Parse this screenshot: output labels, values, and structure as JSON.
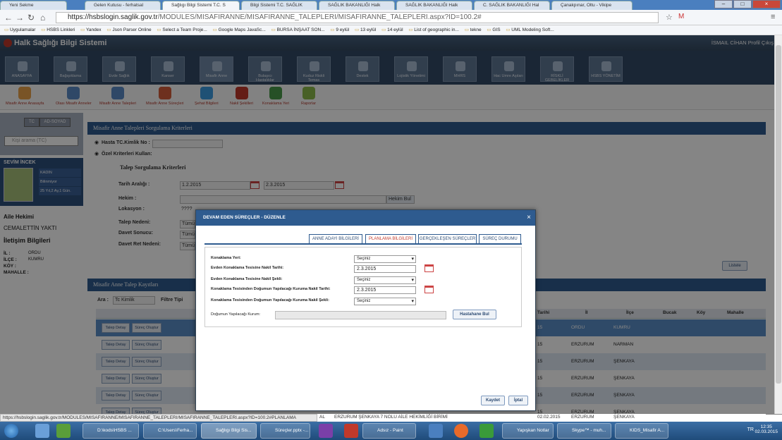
{
  "browser": {
    "tabs": [
      "Yeni Sekme",
      "Gelen Kutusu - ferhatsal",
      "Sağlıgı Bilgi Sistemi T.C. S",
      "Bilgi Sistemi T.C. SAĞLIK",
      "SAĞLIK BAKANLIĞI Halk",
      "SAĞLIK BAKANLIĞI Halk",
      "C. SAĞLIK BAKANLIĞI Hal",
      "Çanakpınar, Oltu - Vikipe"
    ],
    "url_host": "https://hsbslogin.saglik.gov.tr",
    "url_path": "/MODULES/MISAFIRANNE/MISAFIRANNE_TALEPLERI/MISAFIRANNE_TALEPLERI.aspx?ID=100.2#",
    "bookmarks": [
      "Uygulamalar",
      "HSBS Linkleri",
      "Yandex",
      "Json Parser Online",
      "Select a Team Proje...",
      "Google Maps JavaSc...",
      "BURSA İNŞAAT SON...",
      "9 eylül",
      "13 eylül",
      "14 eylül",
      "List of geographic in...",
      "tekne",
      "GIS",
      "UML Modeling Soft..."
    ]
  },
  "app": {
    "title": "Halk Sağlığı Bilgi Sistemi",
    "profile": "İSMAIL CİHAN Profil Çıkış",
    "modules": [
      "ANASAYFA",
      "Bağışıklama",
      "Evde Sağlık",
      "Kanser",
      "Misafir Anne",
      "Bulaşıcı Hastalıklar",
      "Kuduz Riskli Temas",
      "Destek",
      "Lojistik Yönetimi",
      "MHRS",
      "Hac Umre Aşıları",
      "RİSKLİ GEBELİKLER",
      "HSBS YÖNETİM"
    ],
    "submodules": [
      "Misafir Anne Anasayfa",
      "Olası Misafir Anneler",
      "Misafir Anne Talepleri",
      "Misafir Anne Süreçleri",
      "Şehat Bilgileri",
      "Nakil Şekilleri",
      "Konaklama Yeri",
      "Raporlar"
    ]
  },
  "left": {
    "btn_tc": "TC",
    "btn_name": "AD-SOYAD",
    "search_placeholder": "Kişi arama (TC)",
    "user_name": "SEVİM İNCEK",
    "attrs": [
      "KADIN",
      "Bilinmiyor",
      "25 Yıl,2 Ay,1 Gün."
    ],
    "aile_hekimi_label": "Aile Hekimi",
    "aile_hekimi": "CEMALETTİN YAKTI",
    "iletisim": "İletişim Bilgileri",
    "il_label": "İL :",
    "il": "ORDU",
    "ilce_label": "İLÇE :",
    "ilce": "KUMRU",
    "koy_label": "KÖY :",
    "mahalle_label": "MAHALLE :"
  },
  "main": {
    "criteria_title": "Misafir Anne Talepleri Sorgulama Kriterleri",
    "hasta_tc": "Hasta TC.Kimlik No :",
    "ozel": "Özel Kriterleri Kullan:",
    "talep_title": "Talep Sorgulama Kriterleri",
    "tarih_label": "Tarih Aralığı :",
    "tarih_from": "1.2.2015",
    "tarih_to": "2.3.2015",
    "hekim_label": "Hekim :",
    "hekim_bul": "Hekim Bul",
    "lokasyon_label": "Lokasyon :",
    "lokasyon": "????",
    "talep_nedeni": "Talep Nedeni:",
    "davet_sonucu": "Davet Sonucu:",
    "davet_ret": "Davet Ret Nedeni:",
    "tumu": "Tümü",
    "listele": "Listele",
    "records_title": "Misafir Anne Talep Kayıtları",
    "ara": "Ara :",
    "ara_value": "Tc Kimlik",
    "filtre": "Filtre Tipi",
    "columns": [
      "Tarihi",
      "İl",
      "İlçe",
      "Bucak",
      "Köy",
      "Mahalle"
    ],
    "rows": [
      {
        "date": "15",
        "il": "ORDU",
        "ilce": "KUMRU"
      },
      {
        "date": "15",
        "il": "ERZURUM",
        "ilce": "NARMAN"
      },
      {
        "date": "15",
        "il": "ERZURUM",
        "ilce": "ŞENKAYA"
      },
      {
        "date": "15",
        "il": "ERZURUM",
        "ilce": "ŞENKAYA"
      },
      {
        "date": "15",
        "il": "ERZURUM",
        "ilce": "ŞENKAYA"
      },
      {
        "date": "15",
        "il": "ERZURUM",
        "ilce": "ŞENKAYA"
      }
    ],
    "talep_detay": "Talep Detay",
    "surec_olustur": "Süreç Oluştur",
    "last_row_text": "ERZURUM ŞENKAYA 7 NOLU AİLE HEKİMLİĞİ BİRİMİ",
    "last_row_date": "02.02.2015",
    "last_row_il": "ERZURUM",
    "last_row_ilce": "ŞENKAYA",
    "last_row_prefix": "AL"
  },
  "modal": {
    "title": "DEVAM EDEN SÜREÇLER - DÜZENLE",
    "tabs": [
      "ANNE ADAYI BİLGİLERİ",
      "PLANLAMA BİLGİLERİ",
      "GERÇEKLEŞEN SÜREÇLER",
      "SÜREÇ DURUMU"
    ],
    "konaklama_yeri": "Konaklama Yeri:",
    "nakil_tarihi": "Evden Konaklama Tesisine Nakil Tarihi:",
    "nakil_sekli": "Evden Konaklama Tesisine Nakil Şekli:",
    "kurum_nakil_tarihi": "Konaklama Tesisinden Doğumun Yapılacağı Kuruma Nakil Tarihi:",
    "kurum_nakil_sekli": "Konaklama Tesisinden Doğumun Yapılacağı Kuruma Nakil Şekli:",
    "dogum_kurum": "Doğumun Yapılacağı Kurum:",
    "seciniz": "Seçiniz",
    "date1": "2.3.2015",
    "date2": "2.3.2015",
    "hastahane_bul": "Hastahane Bul",
    "kaydet": "Kaydet",
    "iptal": "İptal"
  },
  "status_url": "https://hsbslogin.saglik.gov.tr/MODULES/MISAFIRANNE/MISAFIRANNE_TALEPLERI/MISAFIRANNE_TALEPLERI.aspx?ID=100.2#PLANLAMA",
  "taskbar": {
    "items": [
      "D:\\kods\\HSBS ...",
      "C:\\Users\\Ferha...",
      "Sağlıgı Bilgi Sis...",
      "Süreçler.pptx -...",
      "Adsız - Paint",
      "Yapışkan Notlar",
      "Skype™ - muh...",
      "KIDS_Misafir A..."
    ],
    "lang": "TR",
    "time": "12:35",
    "date": "02.03.2015"
  }
}
